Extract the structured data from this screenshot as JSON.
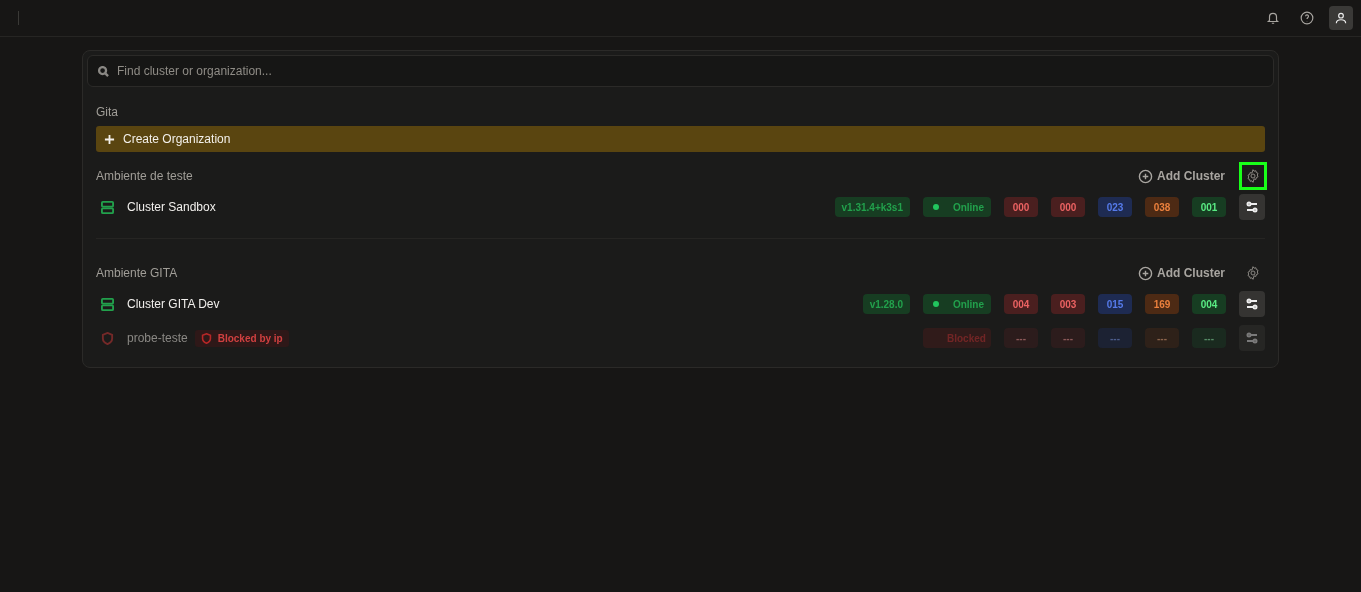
{
  "search": {
    "placeholder": "Find cluster or organization..."
  },
  "organization": {
    "name": "Gita",
    "create_label": "Create Organization"
  },
  "environments": [
    {
      "name": "Ambiente de teste",
      "add_label": "Add Cluster",
      "highlighted": true,
      "clusters": [
        {
          "name": "Cluster Sandbox",
          "kind": "online",
          "version": "v1.31.4+k3s1",
          "status": "Online",
          "counts": [
            {
              "value": "000",
              "color": "#4a1f1f"
            },
            {
              "value": "000",
              "color": "#4a1f1f"
            },
            {
              "value": "023",
              "color": "#1e2b52"
            },
            {
              "value": "038",
              "color": "#4d2a14"
            },
            {
              "value": "001",
              "color": "#173d22"
            }
          ]
        }
      ]
    },
    {
      "name": "Ambiente GITA",
      "add_label": "Add Cluster",
      "highlighted": false,
      "clusters": [
        {
          "name": "Cluster GITA Dev",
          "kind": "online",
          "version": "v1.28.0",
          "status": "Online",
          "counts": [
            {
              "value": "004",
              "color": "#4a1f1f"
            },
            {
              "value": "003",
              "color": "#4a1f1f"
            },
            {
              "value": "015",
              "color": "#1e2b52"
            },
            {
              "value": "169",
              "color": "#4d2a14"
            },
            {
              "value": "004",
              "color": "#173d22"
            }
          ]
        },
        {
          "name": "probe-teste",
          "kind": "blocked",
          "tag": "Blocked by ip",
          "status": "Blocked",
          "counts": [
            {
              "value": "---",
              "color": "#2c1c1c"
            },
            {
              "value": "---",
              "color": "#2c1c1c"
            },
            {
              "value": "---",
              "color": "#1c2233"
            },
            {
              "value": "---",
              "color": "#2e2119"
            },
            {
              "value": "---",
              "color": "#1a2a1f"
            }
          ]
        }
      ]
    }
  ]
}
